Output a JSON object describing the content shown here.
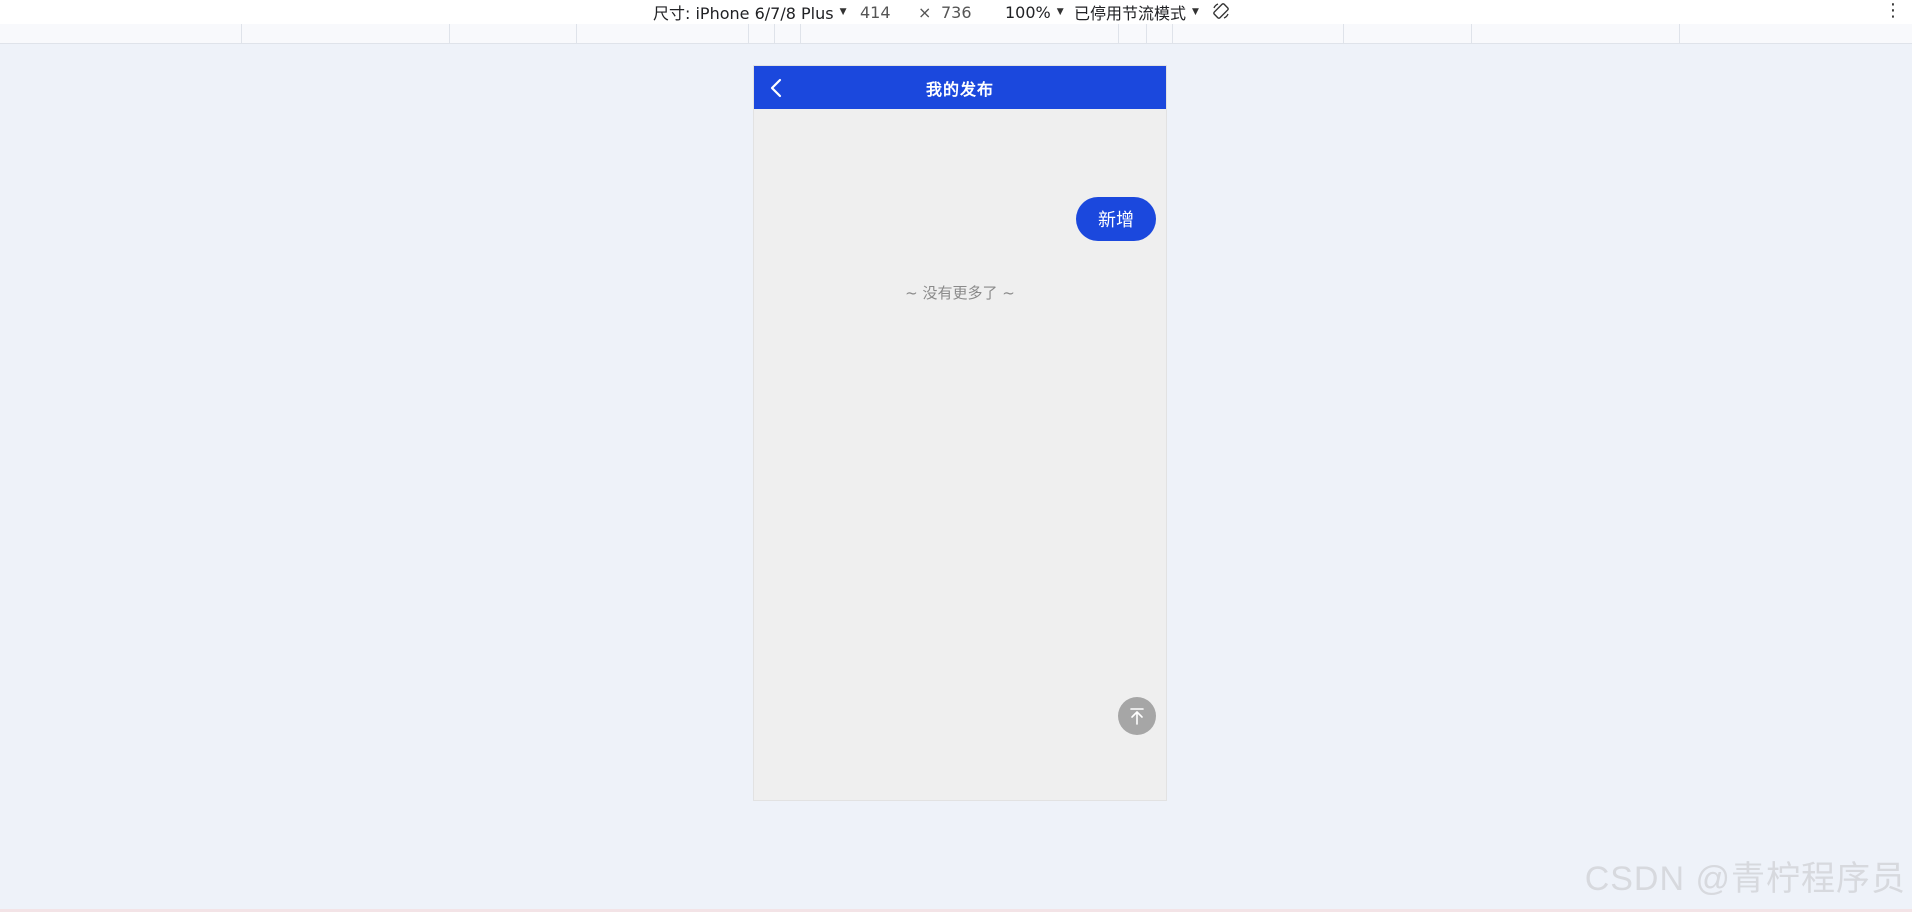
{
  "devtools": {
    "dimensions_label": "尺寸: iPhone 6/7/8 Plus",
    "width_value": "414",
    "times_symbol": "×",
    "height_value": "736",
    "zoom_label": "100%",
    "throttle_label": "已停用节流模式",
    "more_symbol": "⋮"
  },
  "phone": {
    "header": {
      "title": "我的发布",
      "bg_color": "#1b48dd"
    },
    "add_button_label": "新增",
    "no_more_text": "~ 没有更多了 ~"
  },
  "watermark": "CSDN @青柠程序员",
  "icons": {
    "back": "chevron-left-icon",
    "rotate": "rotate-icon",
    "back_to_top": "arrow-up-to-top-icon",
    "dropdown": "caret-down-icon"
  },
  "colors": {
    "accent": "#1b48dd",
    "page_bg": "#eef2f9",
    "phone_bg": "#efefef",
    "back_top_bg": "#a6a6a6"
  }
}
